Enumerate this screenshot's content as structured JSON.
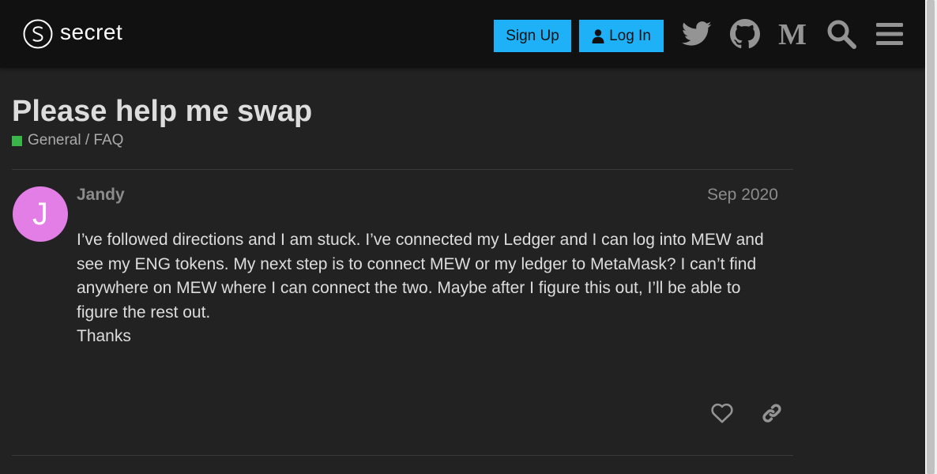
{
  "header": {
    "logo_text": "secret",
    "signup_label": "Sign Up",
    "login_label": "Log In",
    "icons": [
      "twitter-icon",
      "github-icon",
      "medium-icon",
      "search-icon",
      "menu-icon"
    ]
  },
  "topic": {
    "title": "Please help me swap",
    "category": "General / FAQ",
    "category_color": "#3ab54a"
  },
  "post": {
    "avatar_letter": "J",
    "avatar_color": "#e27ee6",
    "username": "Jandy",
    "date": "Sep 2020",
    "body": "I’ve followed directions and I am stuck. I’ve connected my Ledger and I can log into MEW and see my ENG tokens. My next step is to connect MEW or my ledger to MetaMask? I can’t find anywhere on MEW where I can connect the two. Maybe after I figure this out, I’ll be able to figure the rest out.",
    "closing": "Thanks"
  },
  "colors": {
    "accent": "#1eb1f7",
    "header_bg": "#111111",
    "page_bg": "#222222"
  }
}
